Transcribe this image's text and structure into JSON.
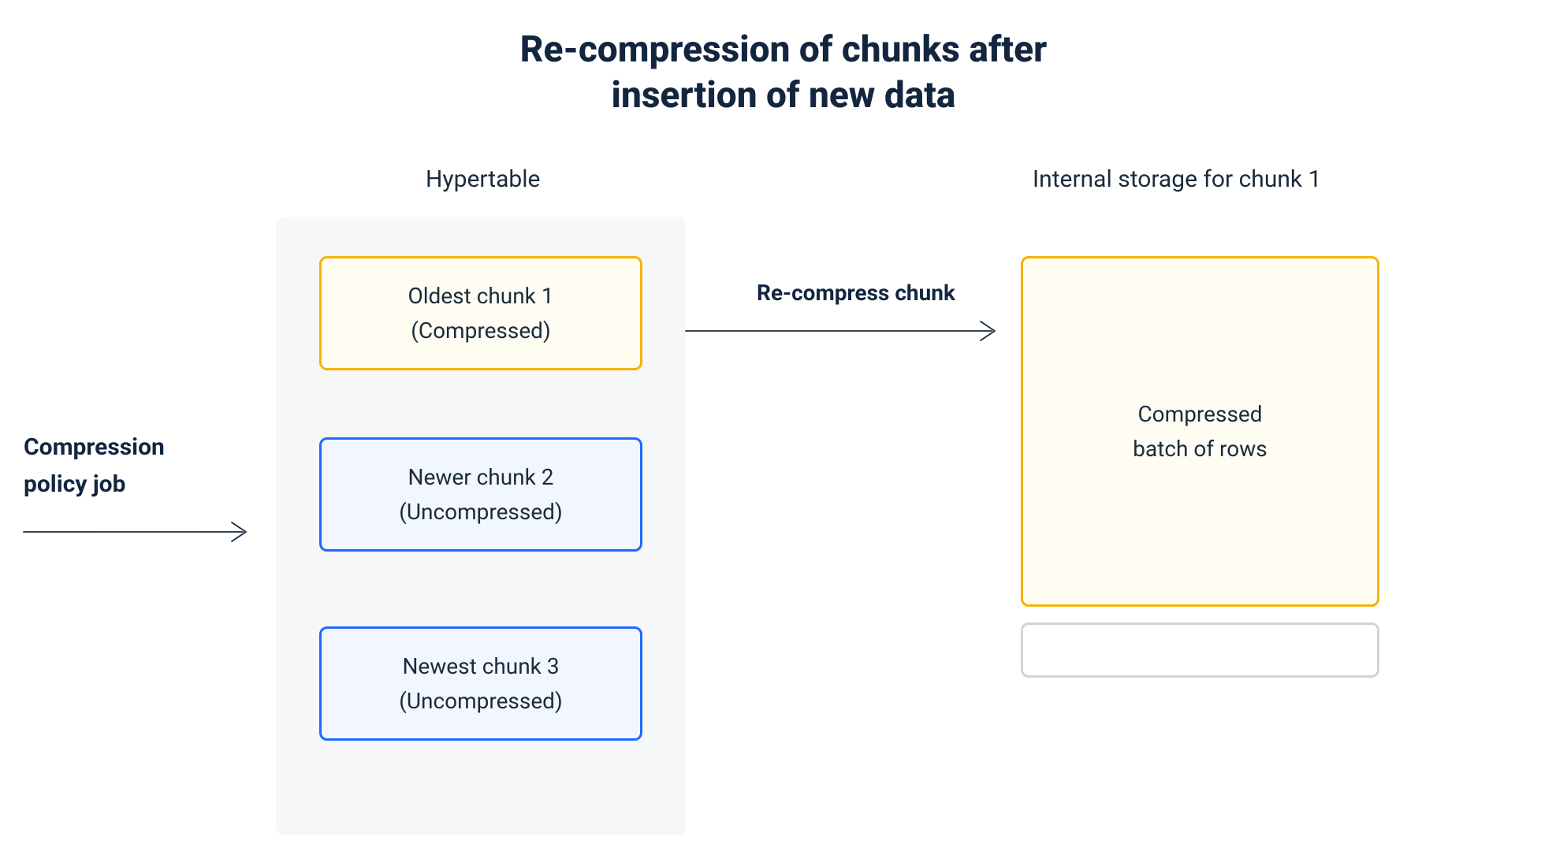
{
  "title_line1": "Re-compression of chunks after",
  "title_line2": "insertion of new data",
  "columns": {
    "hypertable": "Hypertable",
    "storage": "Internal storage for chunk 1"
  },
  "left_label_line1": "Compression",
  "left_label_line2": "policy job",
  "arrow_label": "Re-compress chunk",
  "chunks": [
    {
      "line1": "Oldest chunk 1",
      "line2": "(Compressed)"
    },
    {
      "line1": "Newer chunk 2",
      "line2": "(Uncompressed)"
    },
    {
      "line1": "Newest chunk 3",
      "line2": "(Uncompressed)"
    }
  ],
  "storage_box": {
    "line1": "Compressed",
    "line2": "batch of rows"
  },
  "colors": {
    "compressed_border": "#f5b301",
    "compressed_fill": "#fffcf2",
    "uncompressed_border": "#1e69ff",
    "uncompressed_fill": "#f2f6ff",
    "empty_border": "#cfd4db",
    "text": "#1a2b3d"
  }
}
